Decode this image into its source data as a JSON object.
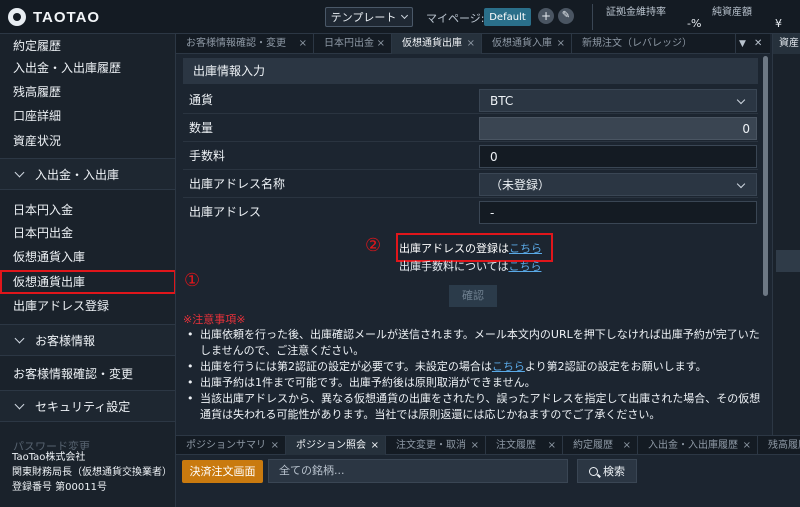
{
  "header": {
    "logo_text": "TAOTAO",
    "template_label": "テンプレート",
    "mypage_label": "マイページ:",
    "default_label": "Default",
    "margin_rate_label": "証拠金維持率",
    "margin_rate_value": "-%",
    "net_assets_label": "純資産額",
    "net_assets_value": "¥"
  },
  "sidebar": {
    "items_top": [
      "約定履歴",
      "入出金・入出庫履歴",
      "残高履歴",
      "口座詳細",
      "資産状況"
    ],
    "section_deposit": "入出金・入出庫",
    "items_deposit": [
      "日本円入金",
      "日本円出金",
      "仮想通貨入庫",
      "仮想通貨出庫",
      "出庫アドレス登録"
    ],
    "section_customer": "お客様情報",
    "items_customer": [
      "お客様情報確認・変更"
    ],
    "section_security": "セキュリティ設定",
    "faded_item": "パスワード変更",
    "footer": [
      "TaoTao株式会社",
      "関東財務局長（仮想通貨交換業者）",
      "登録番号 第00011号"
    ]
  },
  "top_tabs": [
    "お客様情報確認・変更",
    "日本円出金",
    "仮想通貨出庫",
    "仮想通貨入庫",
    "新規注文（レバレッジ）"
  ],
  "right_panel_tab": "資産",
  "form": {
    "title": "出庫情報入力",
    "currency_label": "通貨",
    "currency_value": "BTC",
    "quantity_label": "数量",
    "quantity_value": "0",
    "fee_label": "手数料",
    "fee_value": "0",
    "address_name_label": "出庫アドレス名称",
    "address_name_value": "（未登録）",
    "address_label": "出庫アドレス",
    "address_value": "-",
    "register_text": "出庫アドレスの登録は",
    "register_link": "こちら",
    "fee_info_text": "出庫手数料については",
    "fee_info_link": "こちら",
    "confirm_label": "確認"
  },
  "annotations": {
    "marker_1": "①",
    "marker_2": "②"
  },
  "notes": {
    "title": "※注意事項※",
    "items": [
      "出庫依頼を行った後、出庫確認メールが送信されます。メール本文内のURLを押下しなければ出庫予約が完了いたしませんので、ご注意ください。",
      "出庫を行うには第2認証の設定が必要です。未設定の場合はこちらより第2認証の設定をお願いします。",
      "出庫予約は1件まで可能です。出庫予約後は原則取消ができません。",
      "当該出庫アドレスから、異なる仮想通貨の出庫をされたり、誤ったアドレスを指定して出庫された場合、その仮想通貨は失われる可能性があります。当社では原則返還には応じかねますのでご了承ください。"
    ]
  },
  "bottom_tabs": [
    "ポジションサマリ",
    "ポジション照会",
    "注文変更・取消",
    "注文履歴",
    "約定履歴",
    "入出金・入出庫履歴",
    "残高履歴"
  ],
  "bottom": {
    "order_button": "決済注文画面",
    "search_placeholder": "全ての銘柄...",
    "search_button": "検索"
  }
}
